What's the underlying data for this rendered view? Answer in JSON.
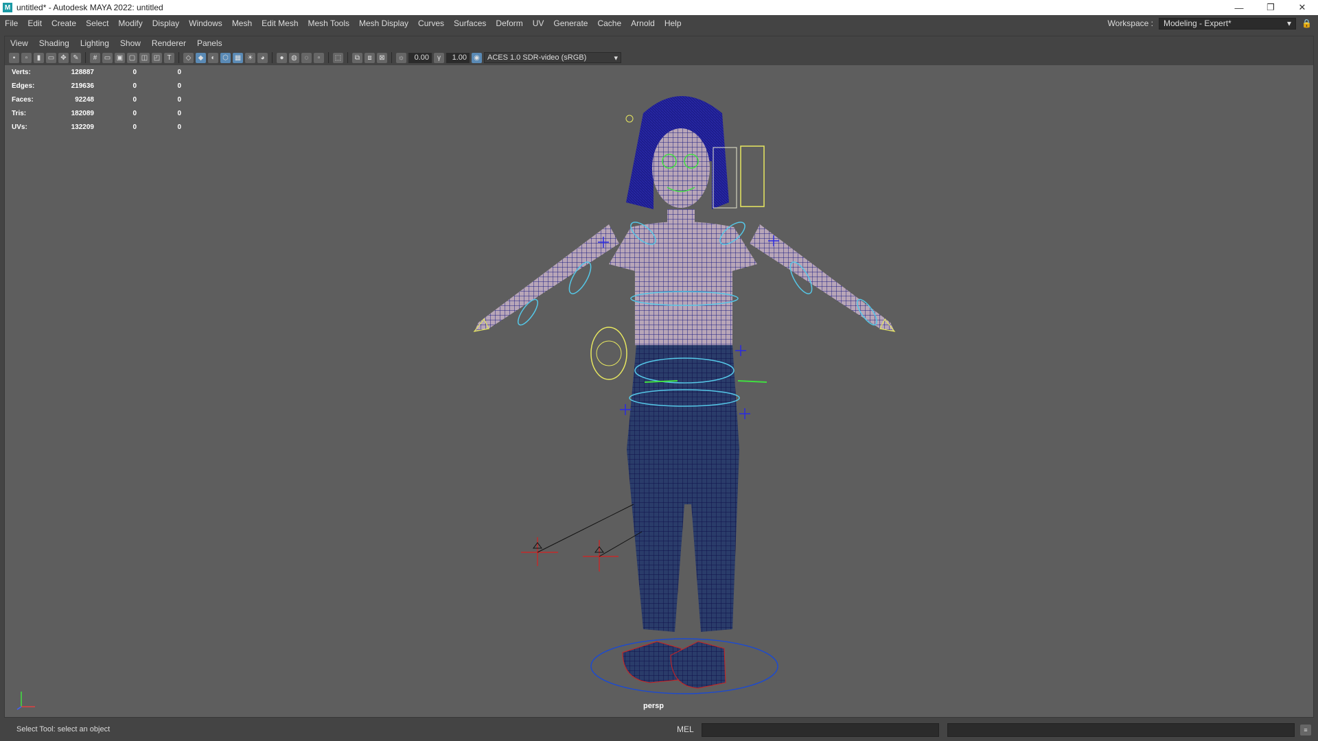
{
  "window": {
    "title": "untitled* - Autodesk MAYA 2022: untitled",
    "logo_letter": "M",
    "minimize_glyph": "—",
    "restore_glyph": "❐",
    "close_glyph": "✕"
  },
  "main_menu": [
    "File",
    "Edit",
    "Create",
    "Select",
    "Modify",
    "Display",
    "Windows",
    "Mesh",
    "Edit Mesh",
    "Mesh Tools",
    "Mesh Display",
    "Curves",
    "Surfaces",
    "Deform",
    "UV",
    "Generate",
    "Cache",
    "Arnold",
    "Help"
  ],
  "workspace": {
    "label": "Workspace :",
    "value": "Modeling - Expert*",
    "lock_icon": "lock-icon"
  },
  "panel_menu": [
    "View",
    "Shading",
    "Lighting",
    "Show",
    "Renderer",
    "Panels"
  ],
  "toolbar": {
    "exposure": "0.00",
    "gamma": "1.00",
    "color_space": "ACES 1.0 SDR-video (sRGB)"
  },
  "hud": [
    {
      "label": "Verts:",
      "v1": "128887",
      "v2": "0",
      "v3": "0"
    },
    {
      "label": "Edges:",
      "v1": "219636",
      "v2": "0",
      "v3": "0"
    },
    {
      "label": "Faces:",
      "v1": "92248",
      "v2": "0",
      "v3": "0"
    },
    {
      "label": "Tris:",
      "v1": "182089",
      "v2": "0",
      "v3": "0"
    },
    {
      "label": "UVs:",
      "v1": "132209",
      "v2": "0",
      "v3": "0"
    }
  ],
  "viewport": {
    "camera_label": "persp",
    "wireframe_color": "#1c1c80",
    "control_curve_color": "#55c8e8",
    "selected_curve_color": "#e8e860",
    "locator_color": "#d82020"
  },
  "statusbar": {
    "help_text": "Select Tool: select an object",
    "language": "MEL"
  }
}
